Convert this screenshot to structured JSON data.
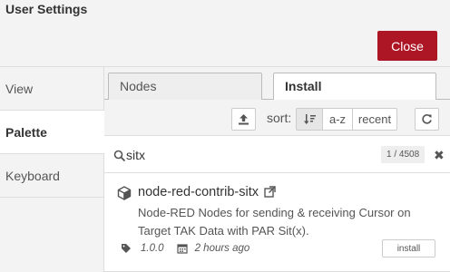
{
  "dialog": {
    "title": "User Settings",
    "close_label": "Close"
  },
  "sidebar": {
    "items": [
      {
        "label": "View",
        "active": false
      },
      {
        "label": "Palette",
        "active": true
      },
      {
        "label": "Keyboard",
        "active": false
      }
    ]
  },
  "tabs": [
    {
      "label": "Nodes",
      "active": false
    },
    {
      "label": "Install",
      "active": true
    }
  ],
  "toolbar": {
    "upload_icon": "upload-icon",
    "sort_label": "sort:",
    "sort_options": [
      {
        "label": "",
        "icon": "sort-relevance-icon",
        "selected": true
      },
      {
        "label": "a-z",
        "selected": false
      },
      {
        "label": "recent",
        "selected": false
      }
    ],
    "refresh_icon": "refresh-icon"
  },
  "search": {
    "value": "sitx",
    "count": "1 / 4508",
    "clear_icon": "close-icon"
  },
  "results": [
    {
      "name": "node-red-contrib-sitx",
      "description": "Node-RED Nodes for sending & receiving Cursor on Target TAK Data with PAR Sit(x).",
      "version": "1.0.0",
      "updated": "2 hours ago",
      "install_label": "install"
    }
  ],
  "colors": {
    "close_button": "#ad1625",
    "panel_bg": "#f3f3f3"
  }
}
